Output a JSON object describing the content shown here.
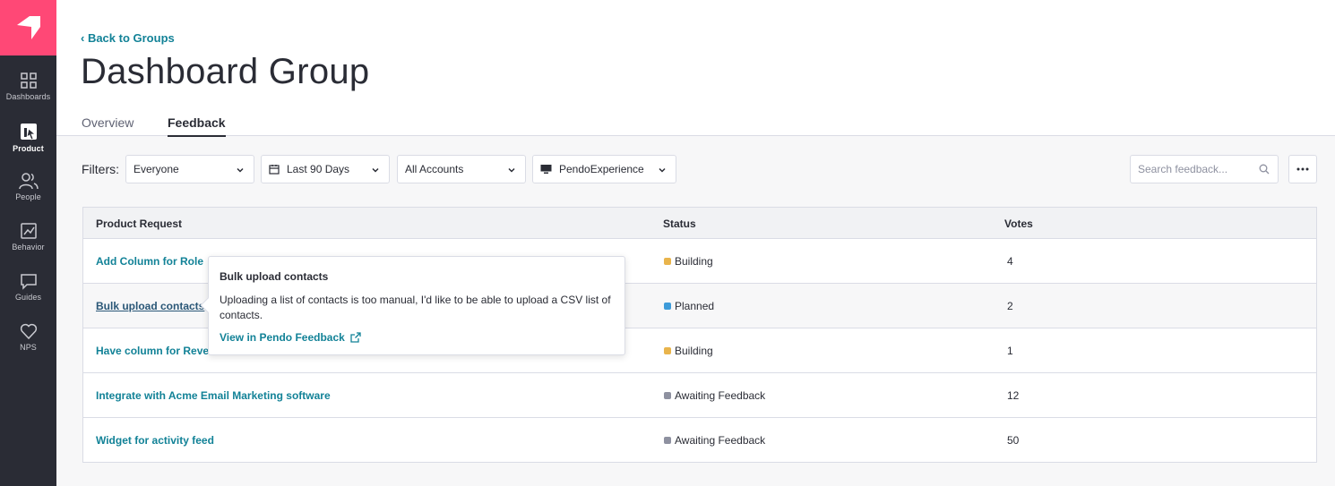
{
  "sidebar": {
    "items": [
      {
        "label": "Dashboards",
        "icon": "grid-icon"
      },
      {
        "label": "Product",
        "icon": "product-icon",
        "active": true
      },
      {
        "label": "People",
        "icon": "people-icon"
      },
      {
        "label": "Behavior",
        "icon": "chart-icon"
      },
      {
        "label": "Guides",
        "icon": "chat-icon"
      },
      {
        "label": "NPS",
        "icon": "heart-icon"
      }
    ]
  },
  "header": {
    "back_link": "‹ Back to Groups",
    "title": "Dashboard Group",
    "tabs": [
      {
        "label": "Overview"
      },
      {
        "label": "Feedback",
        "active": true
      }
    ]
  },
  "filters": {
    "label": "Filters:",
    "segment": "Everyone",
    "date_range": "Last 90 Days",
    "accounts": "All Accounts",
    "app": "PendoExperience",
    "search_placeholder": "Search feedback..."
  },
  "table": {
    "columns": [
      "Product Request",
      "Status",
      "Votes"
    ],
    "rows": [
      {
        "title": "Add Column for Role",
        "status": "Building",
        "status_color": "#e9b44c",
        "votes": "4"
      },
      {
        "title": "Bulk upload contacts",
        "status": "Planned",
        "status_color": "#3d9bd9",
        "votes": "2"
      },
      {
        "title": "Have column for Reven",
        "status": "Building",
        "status_color": "#e9b44c",
        "votes": "1"
      },
      {
        "title": "Integrate with Acme Email Marketing software",
        "status": "Awaiting Feedback",
        "status_color": "#8e91a0",
        "votes": "12"
      },
      {
        "title": "Widget for activity feed",
        "status": "Awaiting Feedback",
        "status_color": "#8e91a0",
        "votes": "50"
      }
    ]
  },
  "tooltip": {
    "title": "Bulk upload contacts",
    "body": "Uploading a list of contacts is too manual, I'd like to be able to upload a CSV list of contacts.",
    "link": "View in Pendo Feedback"
  },
  "colors": {
    "accent": "#128297",
    "brand": "#ff4876",
    "sidebar": "#2a2c35"
  }
}
